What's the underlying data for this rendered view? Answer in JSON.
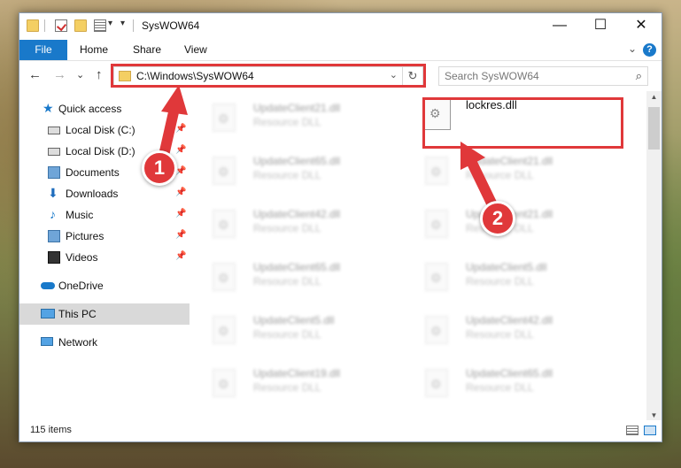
{
  "window": {
    "title": "SysWOW64",
    "buttons": {
      "minimize": "—",
      "maximize": "☐",
      "close": "✕"
    }
  },
  "ribbon": {
    "tabs": [
      "File",
      "Home",
      "Share",
      "View"
    ],
    "expand_glyph": "⌄",
    "help_glyph": "?"
  },
  "address": {
    "path": "C:\\Windows\\SysWOW64",
    "dropdown_glyph": "⌄",
    "refresh_glyph": "↻"
  },
  "nav_buttons": {
    "back": "←",
    "forward": "→",
    "recent": "⌄",
    "up": "↑"
  },
  "search": {
    "placeholder": "Search SysWOW64",
    "icon_glyph": "⌕"
  },
  "sidebar": {
    "pin_glyph": "📌",
    "items": [
      {
        "label": "Quick access",
        "icon": "star-icon",
        "pinned": false
      },
      {
        "label": "Local Disk (C:)",
        "icon": "drive-icon",
        "pinned": true
      },
      {
        "label": "Local Disk (D:)",
        "icon": "drive-icon",
        "pinned": true
      },
      {
        "label": "Documents",
        "icon": "documents-icon",
        "pinned": true
      },
      {
        "label": "Downloads",
        "icon": "downloads-icon",
        "pinned": true
      },
      {
        "label": "Music",
        "icon": "music-icon",
        "pinned": true
      },
      {
        "label": "Pictures",
        "icon": "pictures-icon",
        "pinned": true
      },
      {
        "label": "Videos",
        "icon": "videos-icon",
        "pinned": true
      },
      {
        "label": "OneDrive",
        "icon": "onedrive-icon",
        "pinned": false
      },
      {
        "label": "This PC",
        "icon": "this-pc-icon",
        "pinned": false,
        "selected": true
      },
      {
        "label": "Network",
        "icon": "network-icon",
        "pinned": false
      }
    ]
  },
  "files": [
    {
      "name": "UpdateClient21.dll",
      "type": "Resource DLL"
    },
    {
      "name": "lockres.dll",
      "type": "",
      "highlighted": true
    },
    {
      "name": "UpdateClient65.dll",
      "type": "Resource DLL"
    },
    {
      "name": "UpdateClient21.dll",
      "type": "Resource DLL"
    },
    {
      "name": "UpdateClient42.dll",
      "type": "Resource DLL"
    },
    {
      "name": "UpdateClient21.dll",
      "type": "Resource DLL"
    },
    {
      "name": "UpdateClient65.dll",
      "type": "Resource DLL"
    },
    {
      "name": "UpdateClient5.dll",
      "type": "Resource DLL"
    },
    {
      "name": "UpdateClient5.dll",
      "type": "Resource DLL"
    },
    {
      "name": "UpdateClient42.dll",
      "type": "Resource DLL"
    },
    {
      "name": "UpdateClient19.dll",
      "type": "Resource DLL"
    },
    {
      "name": "UpdateClient65.dll",
      "type": "Resource DLL"
    }
  ],
  "status": {
    "item_count": "115 items"
  },
  "scroll_glyphs": {
    "up": "▲",
    "down": "▼"
  },
  "annotations": {
    "step1": "1",
    "step2": "2",
    "color": "#e0383a"
  },
  "colors": {
    "accent": "#1979ca",
    "annotation": "#e0383a"
  }
}
